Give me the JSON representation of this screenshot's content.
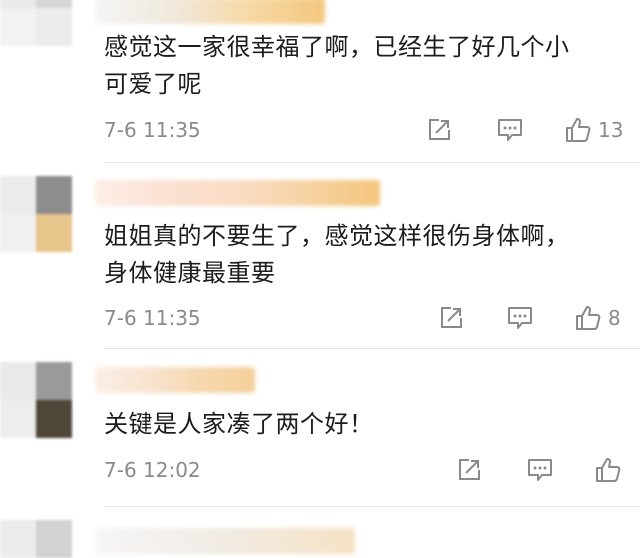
{
  "comments": [
    {
      "text_line1": "感觉这一家很幸福了啊，已经生了好几个小",
      "text_line2": "可爱了呢",
      "time": "7-6 11:35",
      "likes": "13"
    },
    {
      "text_line1": "姐姐真的不要生了，感觉这样很伤身体啊，",
      "text_line2": "身体健康最重要",
      "time": "7-6 11:35",
      "likes": "8"
    },
    {
      "text_line1": "关键是人家凑了两个好！",
      "time": "7-6 12:02",
      "likes": ""
    }
  ],
  "icons": {
    "share": "share-icon",
    "comment": "comment-icon",
    "like": "thumbs-up-icon"
  },
  "colors": {
    "text": "#1c1c1c",
    "meta": "#8a8a8a",
    "icon": "#8a8a8a"
  }
}
